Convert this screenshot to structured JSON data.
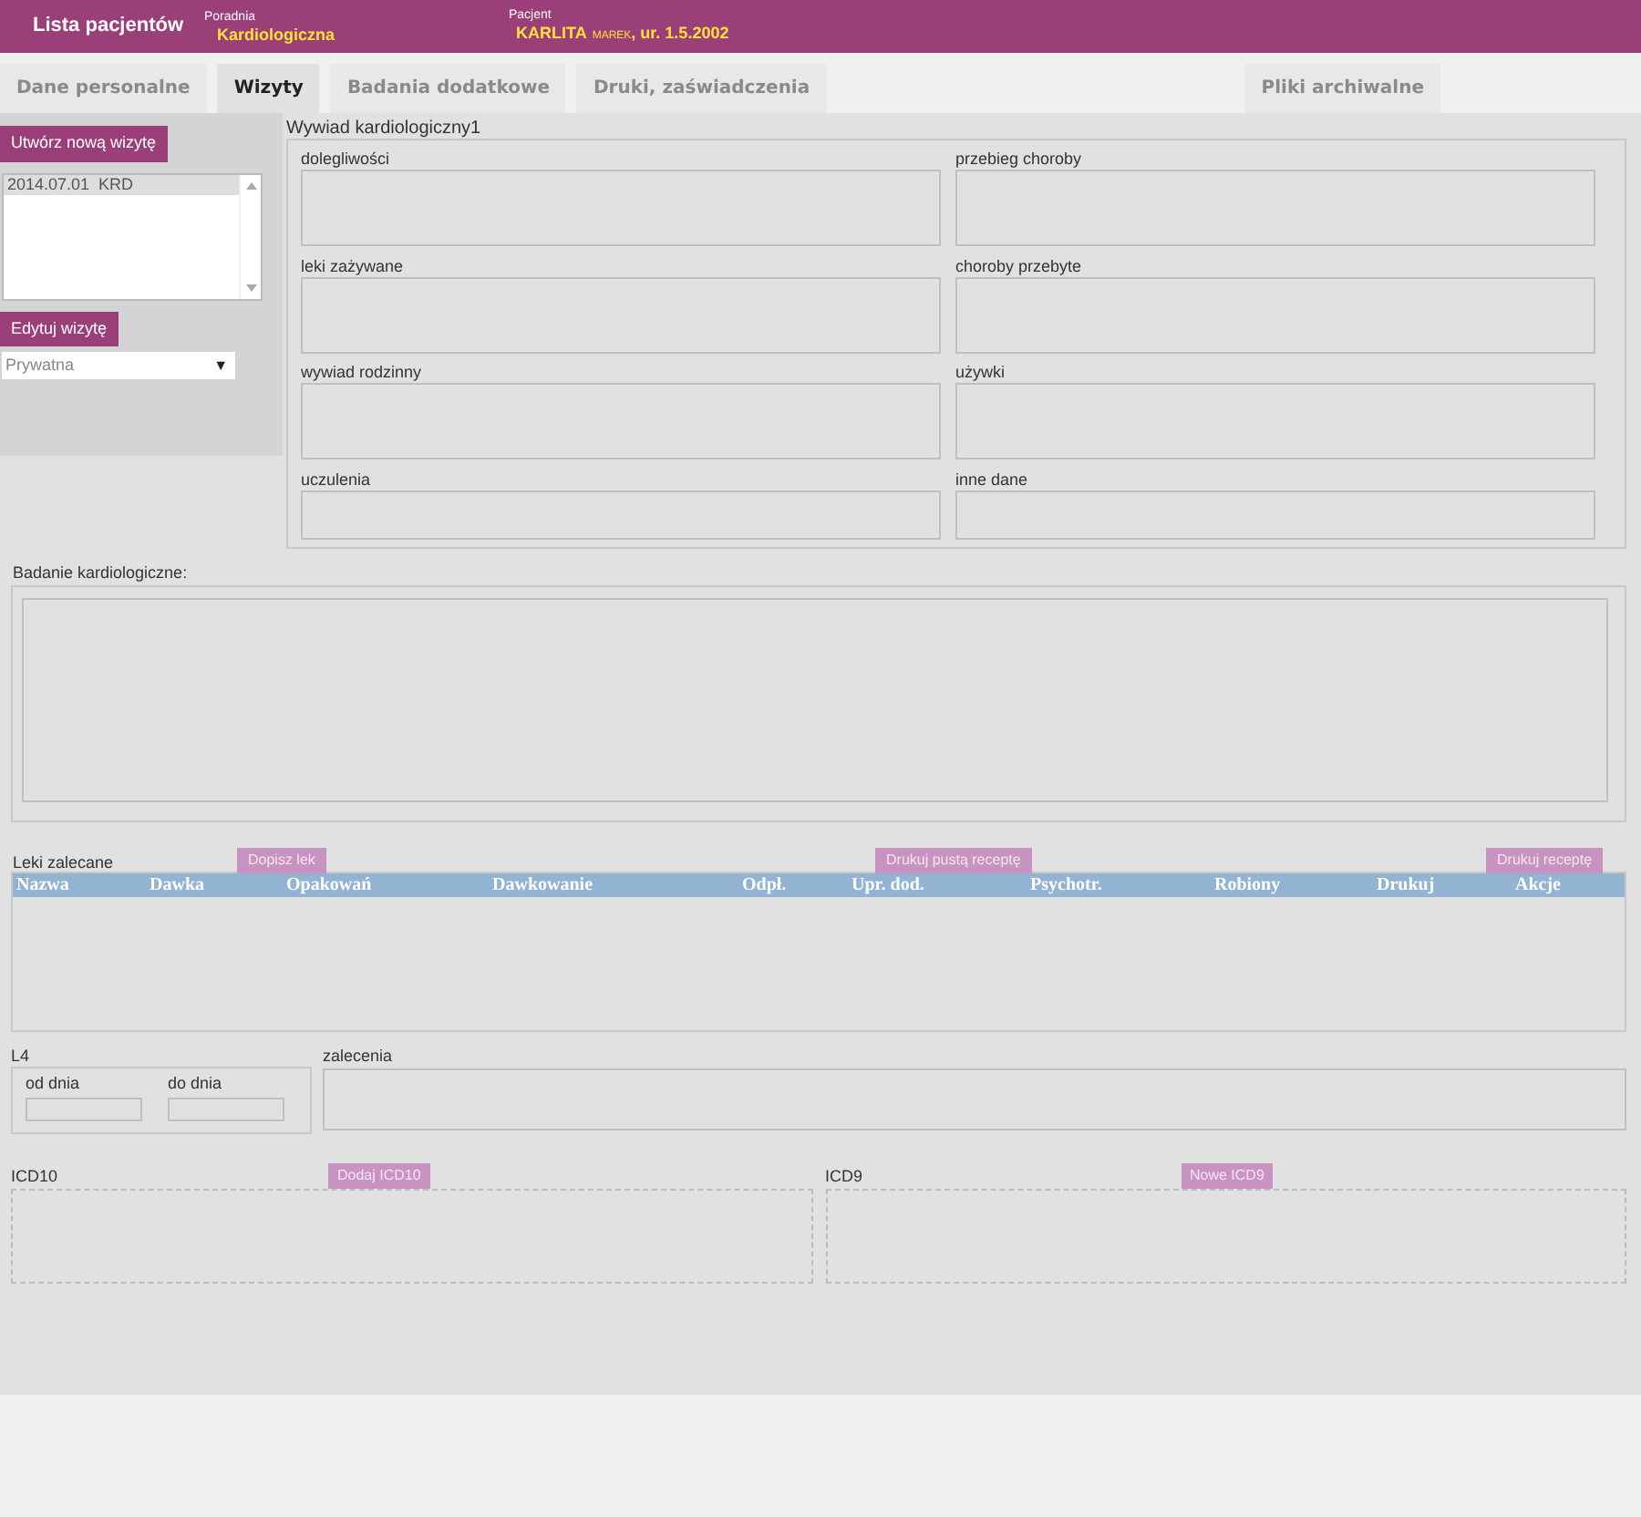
{
  "header": {
    "app_link": "Lista pacjentów",
    "clinic": {
      "label": "Poradnia",
      "name": "Kardiologiczna"
    },
    "patient": {
      "label": "Pacjent",
      "surname": "KARLITA",
      "first_name": "MAREK",
      "birth": ", ur. 1.5.2002"
    }
  },
  "tabs": [
    {
      "label": "Dane personalne",
      "selected": false,
      "kind": "main"
    },
    {
      "label": "Wizyty",
      "selected": true,
      "kind": "main"
    },
    {
      "label": "Badania dodatkowe",
      "selected": false,
      "kind": "main"
    },
    {
      "label": "Druki, zaświadczenia",
      "selected": false,
      "kind": "main"
    },
    {
      "label": "Pliki archiwalne",
      "selected": false,
      "kind": "aside"
    }
  ],
  "sidebar": {
    "new_visit_button": {
      "label": "Utwórz nową wizytę",
      "disabled": false
    },
    "visits": [
      {
        "date": "2014.07.01",
        "code": "KRD",
        "selected": true
      }
    ],
    "edit_button": {
      "label": "Edytuj wizytę",
      "disabled": false
    },
    "visit_type": {
      "value": "Prywatna",
      "arrow": "▼"
    }
  },
  "interview": {
    "title": "Wywiad kardiologiczny1",
    "fields": [
      {
        "label": "dolegliwości",
        "kind": "tall"
      },
      {
        "label": "przebieg choroby",
        "kind": "tall"
      },
      {
        "label": "leki zażywane",
        "kind": "tall"
      },
      {
        "label": "choroby przebyte",
        "kind": "tall"
      },
      {
        "label": "wywiad rodzinny",
        "kind": "tall"
      },
      {
        "label": "używki",
        "kind": "tall"
      },
      {
        "label": "uczulenia",
        "kind": "short"
      },
      {
        "label": "inne dane",
        "kind": "short"
      }
    ]
  },
  "exam": {
    "label": "Badanie kardiologiczne:"
  },
  "medications": {
    "label": "Leki zalecane",
    "buttons": [
      {
        "label": "Dopisz lek",
        "disabled": true
      },
      {
        "label": "Drukuj pustą receptę",
        "disabled": true
      },
      {
        "label": "Drukuj receptę",
        "disabled": true
      }
    ],
    "columns": [
      "Nazwa",
      "Dawka",
      "Opakowań",
      "Dawkowanie",
      "Odpł.",
      "Upr. dod.",
      "Psychotr.",
      "Robiony",
      "Drukuj",
      "Akcje"
    ]
  },
  "l4": {
    "label": "L4",
    "fields": [
      {
        "label": "od dnia"
      },
      {
        "label": "do dnia"
      }
    ]
  },
  "recommendations": {
    "label": "zalecenia"
  },
  "codes": [
    {
      "label": "ICD10",
      "button": {
        "label": "Dodaj ICD10",
        "disabled": true
      }
    },
    {
      "label": "ICD9",
      "button": {
        "label": "Nowe ICD9",
        "disabled": true
      }
    }
  ]
}
